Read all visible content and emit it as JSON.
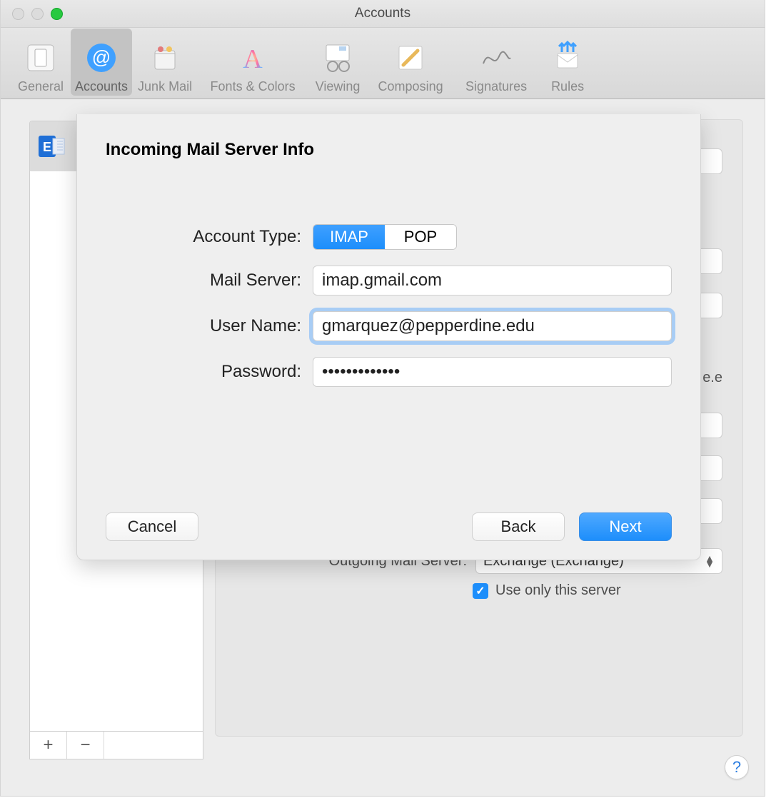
{
  "window": {
    "title": "Accounts"
  },
  "toolbar": {
    "items": [
      {
        "label": "General"
      },
      {
        "label": "Accounts"
      },
      {
        "label": "Junk Mail"
      },
      {
        "label": "Fonts & Colors"
      },
      {
        "label": "Viewing"
      },
      {
        "label": "Composing"
      },
      {
        "label": "Signatures"
      },
      {
        "label": "Rules"
      }
    ],
    "selected_index": 1
  },
  "background_panel": {
    "outgoing_label": "Outgoing Mail Server:",
    "outgoing_value": "Exchange (Exchange)",
    "use_only_label": "Use only this server",
    "use_only_checked": true,
    "peek_text": "e.e"
  },
  "list_buttons": {
    "add": "+",
    "remove": "−"
  },
  "sheet": {
    "title": "Incoming Mail Server Info",
    "labels": {
      "account_type": "Account Type:",
      "mail_server": "Mail Server:",
      "user_name": "User Name:",
      "password": "Password:"
    },
    "account_type_options": {
      "imap": "IMAP",
      "pop": "POP"
    },
    "account_type_selected": "IMAP",
    "mail_server_value": "imap.gmail.com",
    "user_name_value": "gmarquez@pepperdine.edu",
    "password_value": "•••••••••••••",
    "buttons": {
      "cancel": "Cancel",
      "back": "Back",
      "next": "Next"
    }
  },
  "help_button": {
    "label": "?"
  }
}
